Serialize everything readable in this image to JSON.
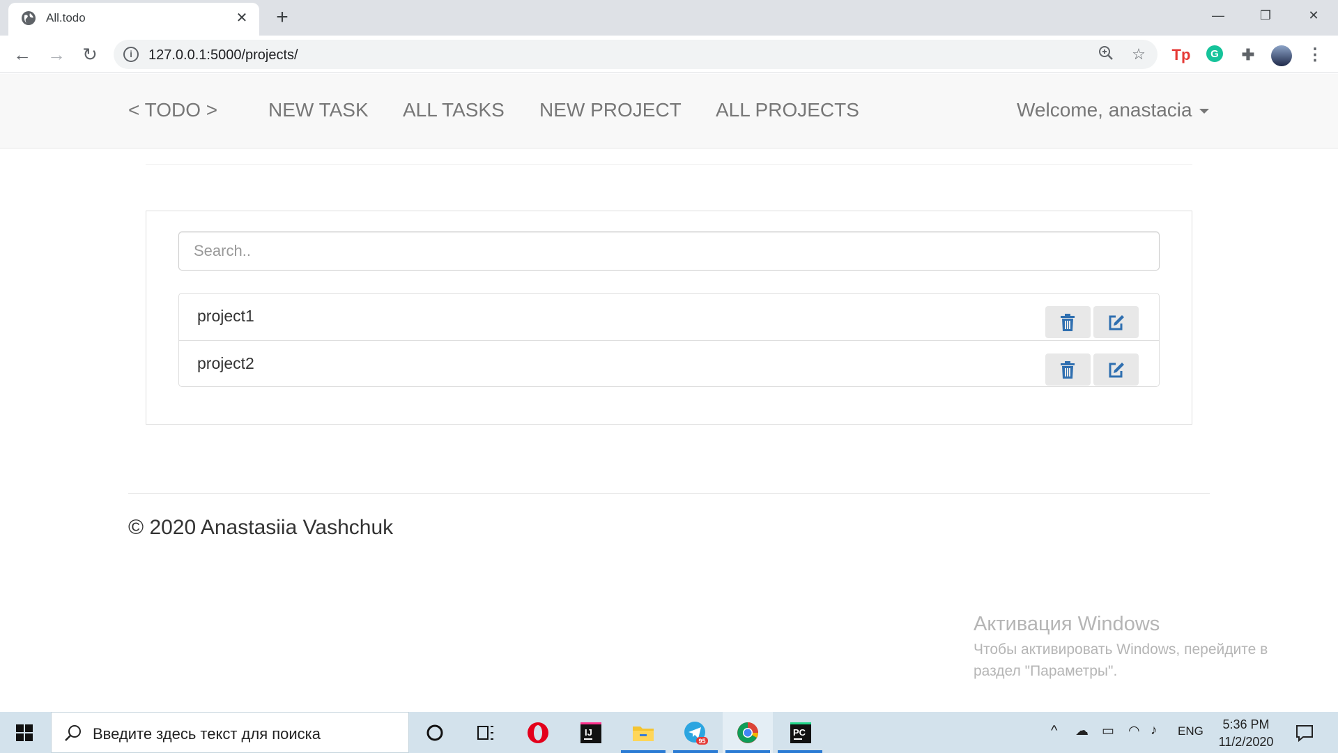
{
  "browser": {
    "tab_title": "All.todo",
    "tab_close": "✕",
    "new_tab": "+",
    "url": "127.0.0.1:5000/projects/",
    "window_controls": {
      "minimize": "—",
      "restore": "❐",
      "close": "✕"
    }
  },
  "navbar": {
    "brand": "< TODO >",
    "links": [
      "NEW TASK",
      "ALL TASKS",
      "NEW PROJECT",
      "ALL PROJECTS"
    ],
    "welcome": "Welcome, anastacia"
  },
  "panel": {
    "search_placeholder": "Search..",
    "projects": [
      {
        "name": "project1"
      },
      {
        "name": "project2"
      }
    ]
  },
  "footer": {
    "text": "© 2020 Anastasiia Vashchuk"
  },
  "watermark": {
    "title": "Активация Windows",
    "text": "Чтобы активировать Windows, перейдите в раздел \"Параметры\"."
  },
  "taskbar": {
    "search_placeholder": "Введите здесь текст для поиска",
    "telegram_badge": "95",
    "language": "ENG",
    "time": "5:36 PM",
    "date": "11/2/2020"
  }
}
